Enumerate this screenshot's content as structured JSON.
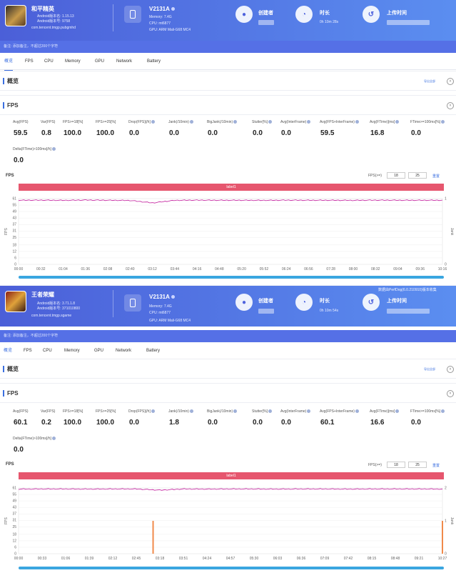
{
  "panels": [
    {
      "app": {
        "name": "和平精英",
        "version_label": "Android版本名: 1.15.13",
        "code_label": "Android版本号: 9758",
        "package": "com.tencent.tmgp.pubgmhd"
      },
      "device": {
        "name": "V2131A",
        "memory": "Memory: 7.4G",
        "cpu": "CPU: mt6877",
        "gpu": "GPU: ARM Mali-G68 MC4"
      },
      "creator_label": "创建者",
      "duration_label": "时长",
      "duration_value": "0h 10m 28s",
      "upload_label": "上传时间",
      "note": "备注: 添加备注，不超过200个字符",
      "version_text": "",
      "tabs": [
        "概览",
        "FPS",
        "CPU",
        "Memory",
        "GPU",
        "Network",
        "Battery"
      ],
      "overview_title": "概览",
      "export_label": "导出全部",
      "fps_title": "FPS",
      "stats": [
        {
          "label": "Avg(FPS)",
          "value": "59.5"
        },
        {
          "label": "Var(FPS)",
          "value": "0.8"
        },
        {
          "label": "FPS>=18[%]",
          "value": "100.0"
        },
        {
          "label": "FPS>=25[%]",
          "value": "100.0"
        },
        {
          "label": "Drop(FPS)[/h]",
          "value": "0.0"
        },
        {
          "label": "Jank(/10min)",
          "value": "0.0"
        },
        {
          "label": "BigJank(/10min)",
          "value": "0.0"
        },
        {
          "label": "Stutter[%]",
          "value": "0.0"
        },
        {
          "label": "Avg(InterFrame)",
          "value": "0.0"
        },
        {
          "label": "Avg(FPS+InterFrame)",
          "value": "59.5"
        },
        {
          "label": "Avg(FTime)[ms]",
          "value": "16.8"
        },
        {
          "label": "FTime>=100ms[%]",
          "value": "0.0"
        },
        {
          "label": "Delta(FTime)>100ms[/h]",
          "value": "0.0"
        }
      ],
      "chart_title": "FPS",
      "fps_gt_label": "FPS(>=)",
      "fps_in1": "18",
      "fps_in2": "25",
      "reset_label": "重置",
      "legend": "label1",
      "y_axis_label": "FPS",
      "y2_axis_label": "Jank"
    },
    {
      "app": {
        "name": "王者荣耀",
        "version_label": "Android版本名: 3.71.1.8",
        "code_label": "Android版本号: 371010800",
        "package": "com.tencent.tmgp.sgame"
      },
      "device": {
        "name": "V2131A",
        "memory": "Memory: 7.4G",
        "cpu": "CPU: mt6877",
        "gpu": "GPU: ARM Mali-G68 MC4"
      },
      "creator_label": "创建者",
      "duration_label": "时长",
      "duration_value": "0h 10m 54s",
      "upload_label": "上传时间",
      "note": "备注: 添加备注，不超过200个字符",
      "version_text": "数据由PerfDog(6.0.210910)版本收集",
      "tabs": [
        "概览",
        "FPS",
        "CPU",
        "Memory",
        "GPU",
        "Network",
        "Battery"
      ],
      "overview_title": "概览",
      "export_label": "导出全部",
      "fps_title": "FPS",
      "stats": [
        {
          "label": "Avg(FPS)",
          "value": "60.1"
        },
        {
          "label": "Var(FPS)",
          "value": "0.2"
        },
        {
          "label": "FPS>=18[%]",
          "value": "100.0"
        },
        {
          "label": "FPS>=25[%]",
          "value": "100.0"
        },
        {
          "label": "Drop(FPS)[/h]",
          "value": "0.0"
        },
        {
          "label": "Jank(/10min)",
          "value": "1.8"
        },
        {
          "label": "BigJank(/10min)",
          "value": "0.0"
        },
        {
          "label": "Stutter[%]",
          "value": "0.0"
        },
        {
          "label": "Avg(InterFrame)",
          "value": "0.0"
        },
        {
          "label": "Avg(FPS+InterFrame)",
          "value": "60.1"
        },
        {
          "label": "Avg(FTime)[ms]",
          "value": "16.6"
        },
        {
          "label": "FTime>=100ms[%]",
          "value": "0.0"
        },
        {
          "label": "Delta(FTime)>100ms[/h]",
          "value": "0.0"
        }
      ],
      "chart_title": "FPS",
      "fps_gt_label": "FPS(>=)",
      "fps_in1": "18",
      "fps_in2": "25",
      "reset_label": "重置",
      "legend": "label1",
      "y_axis_label": "FPS",
      "y2_axis_label": "Jank"
    }
  ],
  "colors": {
    "header_start": "#4b5fd8",
    "header_end": "#5b8ef0",
    "fps_line": "#c0189a",
    "legend": "#e6566e",
    "jank": "#f08a4b",
    "accent": "#3b6fe0"
  },
  "chart_data": [
    {
      "type": "line",
      "title": "FPS",
      "ylabel": "FPS",
      "y2label": "Jank",
      "yticks": [
        0,
        6,
        12,
        18,
        25,
        31,
        37,
        43,
        49,
        55,
        61
      ],
      "ylim": [
        0,
        61
      ],
      "y2lim": [
        0,
        1
      ],
      "y2ticks": [
        0,
        1
      ],
      "xticks": [
        "00:00",
        "00:32",
        "01:04",
        "01:36",
        "02:08",
        "02:40",
        "03:12",
        "03:44",
        "04:16",
        "04:48",
        "05:20",
        "05:52",
        "06:24",
        "06:56",
        "07:28",
        "08:00",
        "08:32",
        "09:04",
        "09:36",
        "10:16"
      ],
      "series": [
        {
          "name": "label1",
          "values": [
            59.5,
            59.6,
            59.4,
            59.7,
            59.5,
            59.3,
            57.0,
            59.4,
            59.6,
            59.5,
            59.5,
            59.4,
            59.6,
            59.5,
            59.5,
            59.4,
            59.6,
            59.5,
            59.5,
            59.5
          ]
        }
      ],
      "jank": []
    },
    {
      "type": "line",
      "title": "FPS",
      "ylabel": "FPS",
      "y2label": "Jank",
      "yticks": [
        0,
        6,
        12,
        18,
        25,
        31,
        37,
        43,
        49,
        55,
        61
      ],
      "ylim": [
        0,
        61
      ],
      "y2lim": [
        0,
        2
      ],
      "y2ticks": [
        0,
        1,
        2
      ],
      "xticks": [
        "00:00",
        "00:33",
        "01:06",
        "01:39",
        "02:12",
        "02:45",
        "03:18",
        "03:51",
        "04:24",
        "04:57",
        "05:30",
        "06:03",
        "06:36",
        "07:09",
        "07:42",
        "08:15",
        "08:48",
        "09:21",
        "10:27"
      ],
      "series": [
        {
          "name": "label1",
          "values": [
            60.0,
            60.1,
            60.1,
            60.0,
            60.1,
            60.1,
            59.0,
            60.1,
            60.0,
            60.1,
            60.1,
            60.0,
            60.1,
            60.1,
            60.0,
            60.1,
            60.1,
            60.1,
            60.0
          ]
        }
      ],
      "jank": [
        {
          "x": "03:19",
          "value": 1
        },
        {
          "x": "10:27",
          "value": 1
        }
      ]
    }
  ]
}
